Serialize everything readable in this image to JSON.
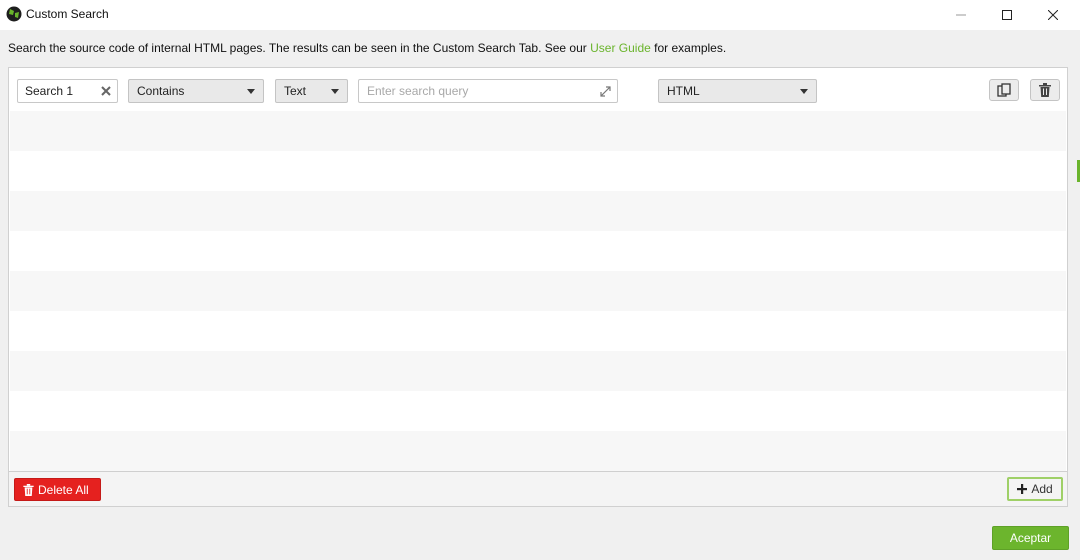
{
  "window": {
    "title": "Custom Search",
    "icon": "app-globe-icon",
    "controls": [
      "minimize-icon",
      "maximize-icon",
      "close-icon"
    ]
  },
  "description": {
    "before_link": "Search the source code of internal HTML pages. The results can be seen in the Custom Search Tab. See our ",
    "link": "User Guide",
    "after_link": " for examples."
  },
  "search_row": {
    "name_value": "Search 1",
    "match_mode": "Contains",
    "query_type": "Text",
    "query_value": "",
    "query_placeholder": "Enter search query",
    "scope": "HTML"
  },
  "footer": {
    "delete_all_label": "Delete All",
    "add_label": "Add"
  },
  "dialog": {
    "accept_label": "Aceptar"
  },
  "colors": {
    "accent_green": "#6ab42c",
    "delete_red": "#e5211f",
    "accept_green": "#6cb52d"
  }
}
